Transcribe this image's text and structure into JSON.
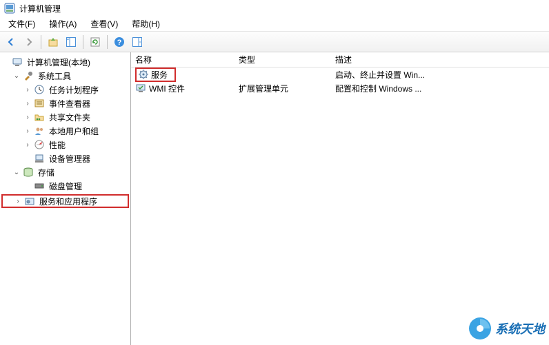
{
  "title": "计算机管理",
  "menu": {
    "file": "文件(F)",
    "action": "操作(A)",
    "view": "查看(V)",
    "help": "帮助(H)"
  },
  "tree": {
    "root": "计算机管理(本地)",
    "system_tools": "系统工具",
    "task_scheduler": "任务计划程序",
    "event_viewer": "事件查看器",
    "shared_folders": "共享文件夹",
    "local_users": "本地用户和组",
    "performance": "性能",
    "device_manager": "设备管理器",
    "storage": "存储",
    "disk_management": "磁盘管理",
    "services_apps": "服务和应用程序"
  },
  "columns": {
    "name": "名称",
    "type": "类型",
    "description": "描述"
  },
  "rows": {
    "services": {
      "name": "服务",
      "type": "",
      "description": "启动、终止并设置 Win..."
    },
    "wmi": {
      "name": "WMI 控件",
      "type": "扩展管理单元",
      "description": "配置和控制 Windows ..."
    }
  },
  "watermark": "系统天地"
}
